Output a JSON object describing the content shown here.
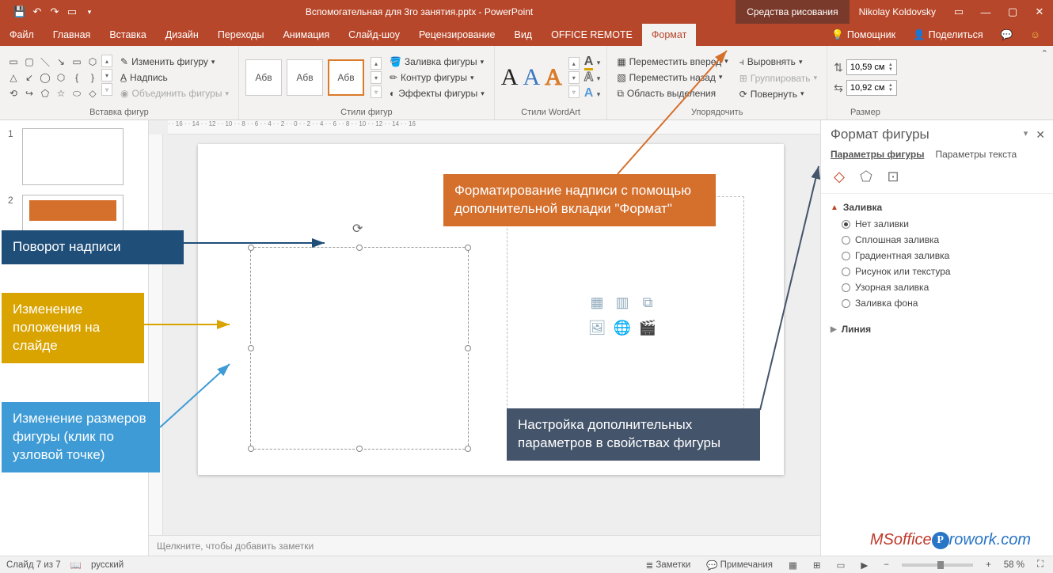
{
  "titlebar": {
    "title": "Вспомогательная для 3го занятия.pptx - PowerPoint",
    "context_tool": "Средства рисования",
    "user": "Nikolay Koldovsky"
  },
  "tabs": {
    "items": [
      "Файл",
      "Главная",
      "Вставка",
      "Дизайн",
      "Переходы",
      "Анимация",
      "Слайд-шоу",
      "Рецензирование",
      "Вид",
      "OFFICE REMOTE",
      "Формат"
    ],
    "active": "Формат",
    "help": "Помощник",
    "share": "Поделиться"
  },
  "ribbon": {
    "insert_shapes": {
      "label": "Вставка фигур",
      "edit_shape": "Изменить фигуру",
      "text_box": "Надпись",
      "merge": "Объединить фигуры"
    },
    "shape_styles": {
      "label": "Стили фигур",
      "tile": "Абв",
      "fill": "Заливка фигуры",
      "outline": "Контур фигуры",
      "effects": "Эффекты фигуры"
    },
    "wordart": {
      "label": "Стили WordArt"
    },
    "arrange": {
      "label": "Упорядочить",
      "bring_forward": "Переместить вперед",
      "send_backward": "Переместить назад",
      "selection_pane": "Область выделения",
      "align": "Выровнять",
      "group": "Группировать",
      "rotate": "Повернуть"
    },
    "size": {
      "label": "Размер",
      "height": "10,59 см",
      "width": "10,92 см"
    }
  },
  "thumbs": {
    "n1": "1",
    "n2": "2"
  },
  "pane": {
    "title": "Формат фигуры",
    "tab_shape": "Параметры фигуры",
    "tab_text": "Параметры текста",
    "fill_section": "Заливка",
    "line_section": "Линия",
    "opts": {
      "none": "Нет заливки",
      "solid": "Сплошная заливка",
      "gradient": "Градиентная заливка",
      "picture": "Рисунок или текстура",
      "pattern": "Узорная заливка",
      "slidebg": "Заливка фона"
    }
  },
  "notes_placeholder": "Щелкните, чтобы добавить заметки",
  "status": {
    "slide": "Слайд 7 из 7",
    "lang": "русский",
    "notes": "Заметки",
    "comments": "Примечания",
    "zoom": "58 %"
  },
  "callouts": {
    "rotate": "Поворот надписи",
    "move": "Изменение положения на слайде",
    "resize": "Изменение размеров фигуры (клик по узловой точке)",
    "format_tab": "Форматирование надписи с помощью дополнительной вкладки \"Формат\"",
    "props": "Настройка дополнительных параметров в свойствах фигуры"
  },
  "watermark": {
    "a": "MSoffice",
    "b": "rowork.com",
    "badge": "P"
  }
}
